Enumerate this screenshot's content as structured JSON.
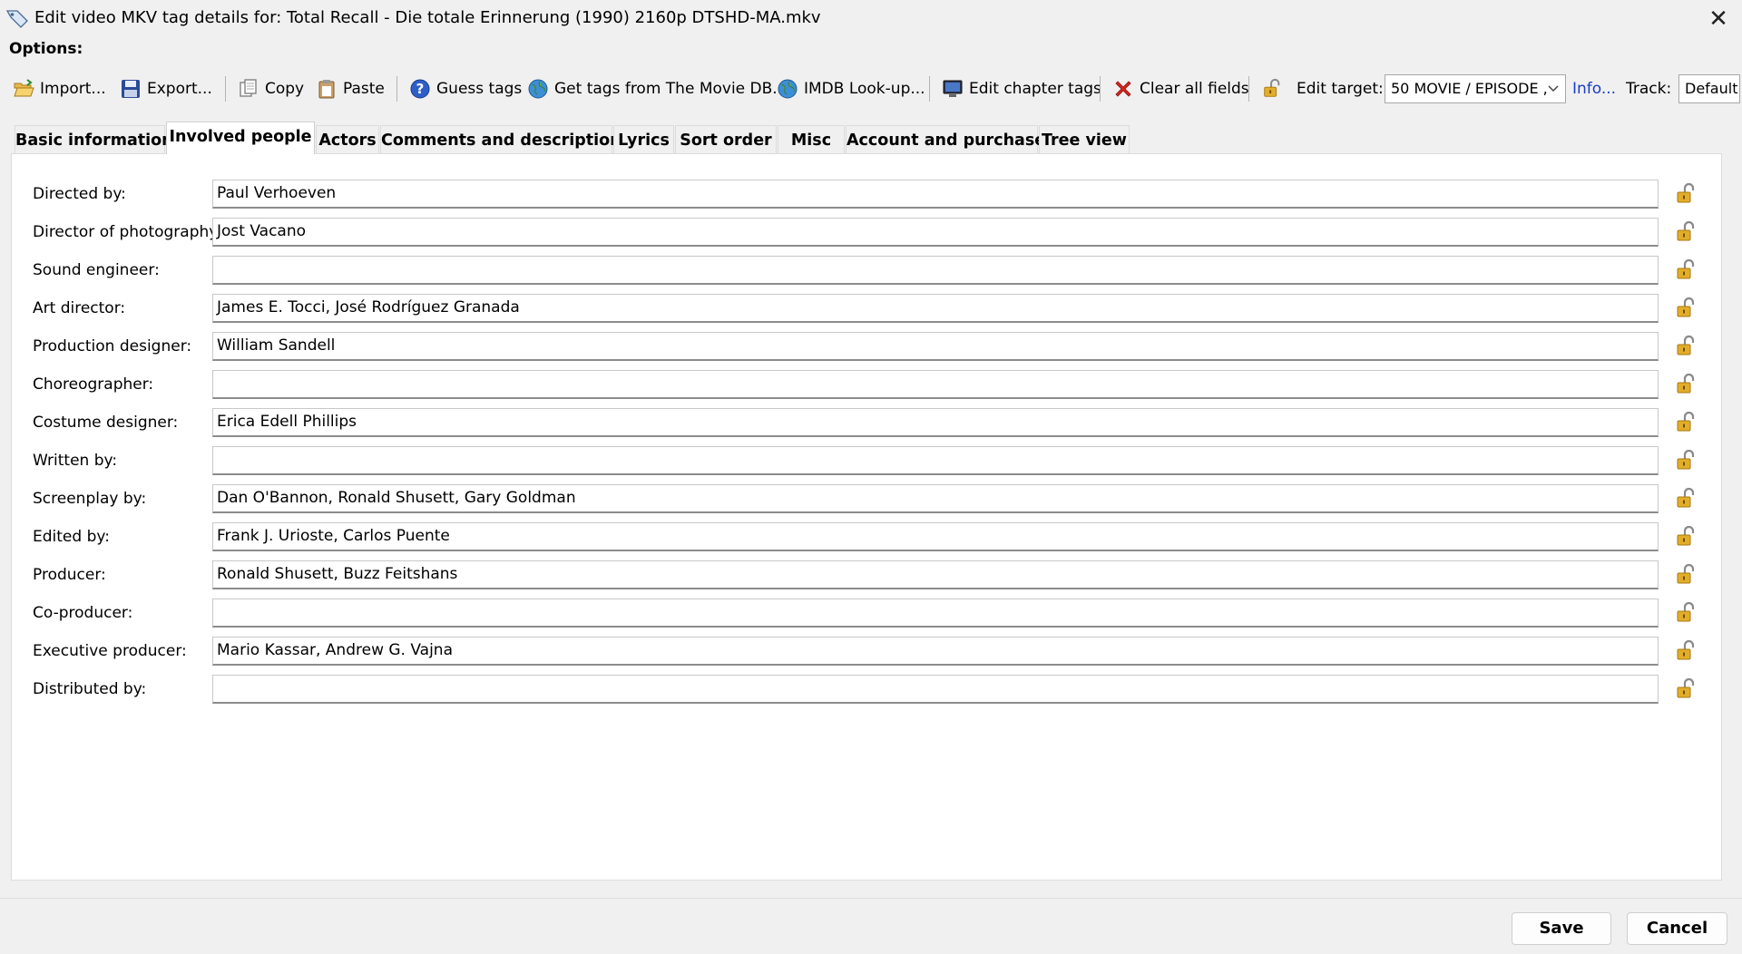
{
  "window": {
    "title": "Edit video MKV tag details for: Total Recall - Die totale Erinnerung (1990) 2160p DTSHD-MA.mkv",
    "close_glyph": "✕"
  },
  "options_label": "Options:",
  "toolbar": {
    "import": "Import...",
    "export": "Export...",
    "copy": "Copy",
    "paste": "Paste",
    "guess_tags": "Guess tags",
    "get_tags_tmdb": "Get tags from The Movie DB...",
    "imdb_lookup": "IMDB Look-up...",
    "edit_chapter_tags": "Edit chapter tags",
    "clear_all_fields": "Clear all fields",
    "edit_target_label": "Edit target:",
    "edit_target_value": "50 MOVIE / EPISODE ,",
    "info_link": "Info...",
    "track_label": "Track:",
    "track_value": "Default"
  },
  "tabs": [
    {
      "label": "Basic information"
    },
    {
      "label": "Involved people"
    },
    {
      "label": "Actors"
    },
    {
      "label": "Comments and description"
    },
    {
      "label": "Lyrics"
    },
    {
      "label": "Sort order"
    },
    {
      "label": "Misc"
    },
    {
      "label": "Account and purchase"
    },
    {
      "label": "Tree view"
    }
  ],
  "fields": [
    {
      "label": "Directed by:",
      "value": "Paul Verhoeven"
    },
    {
      "label": "Director of photography:",
      "value": "Jost Vacano"
    },
    {
      "label": "Sound engineer:",
      "value": ""
    },
    {
      "label": "Art director:",
      "value": "James E. Tocci, José Rodríguez Granada"
    },
    {
      "label": "Production designer:",
      "value": "William Sandell"
    },
    {
      "label": "Choreographer:",
      "value": ""
    },
    {
      "label": "Costume designer:",
      "value": "Erica Edell Phillips"
    },
    {
      "label": "Written by:",
      "value": ""
    },
    {
      "label": "Screenplay by:",
      "value": "Dan O'Bannon, Ronald Shusett, Gary Goldman"
    },
    {
      "label": "Edited by:",
      "value": "Frank J. Urioste, Carlos Puente"
    },
    {
      "label": "Producer:",
      "value": "Ronald Shusett, Buzz Feitshans"
    },
    {
      "label": "Co-producer:",
      "value": ""
    },
    {
      "label": "Executive producer:",
      "value": "Mario Kassar, Andrew G. Vajna"
    },
    {
      "label": "Distributed by:",
      "value": ""
    }
  ],
  "buttons": {
    "save": "Save",
    "cancel": "Cancel"
  },
  "icons": {
    "lock": "padlock-open-icon",
    "tag": "tag-icon"
  },
  "colors": {
    "link": "#1a3ec8",
    "lock": "#d8a21c",
    "clear_x": "#d9241c"
  }
}
